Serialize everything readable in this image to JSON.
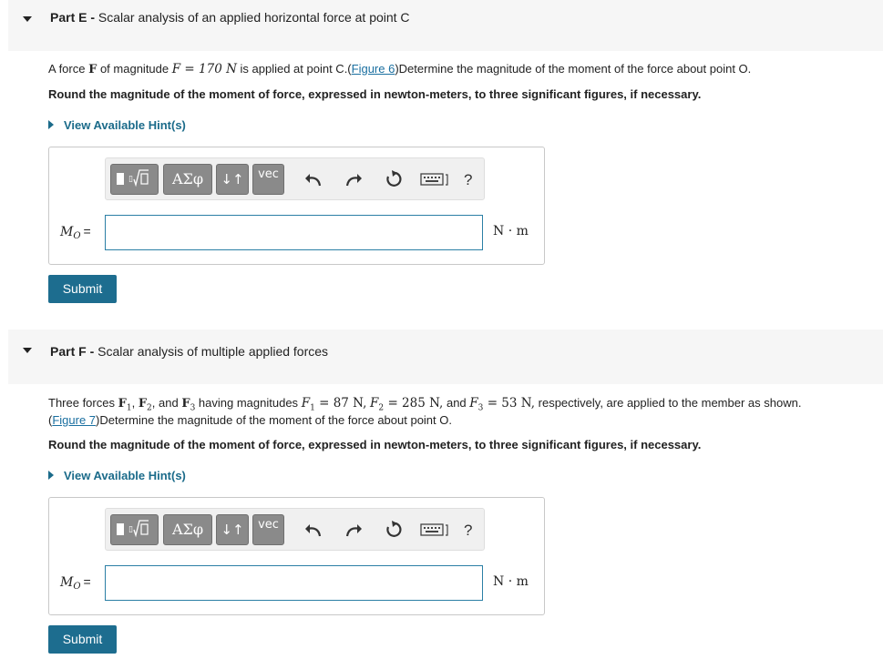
{
  "partE": {
    "label": "Part E -",
    "title": "Scalar analysis of an applied horizontal force at point C",
    "text_pre": "A force",
    "force_symbol": "F",
    "text_mid": "of magnitude",
    "magnitude_eq": "F = 170 N",
    "text_after_mag": "is applied at point C.(",
    "figure_link": "Figure 6",
    "text_post": ")Determine the magnitude of the moment of the force about point O.",
    "instruction": "Round the magnitude of the moment of force, expressed in newton-meters, to three significant figures, if necessary.",
    "hint": "View Available Hint(s)",
    "answer_label": "M",
    "answer_label_sub": "O",
    "answer_label_eq": "=",
    "answer_value": "",
    "unit": "N · m",
    "submit": "Submit"
  },
  "partF": {
    "label": "Part F -",
    "title": "Scalar analysis of multiple applied forces",
    "text_pre": "Three forces",
    "f1": "F",
    "f1_sub": "1",
    "f2": "F",
    "f2_sub": "2",
    "and1": ", and",
    "f3": "F",
    "f3_sub": "3",
    "text_mid": "having magnitudes",
    "m1": "F",
    "m1_sub": "1",
    "m1_val": "= 87 N,",
    "m2": "F",
    "m2_sub": "2",
    "m2_val": "= 285 N,",
    "and2": "and",
    "m3": "F",
    "m3_sub": "3",
    "m3_val": "= 53 N,",
    "text_end": "respectively, are applied to the member as shown.",
    "line2_open": "(",
    "figure_link": "Figure 7",
    "text_post": ")Determine the magnitude of the moment of the force about point O.",
    "instruction": "Round the magnitude of the moment of force, expressed in newton-meters, to three significant figures, if necessary.",
    "hint": "View Available Hint(s)",
    "answer_label": "M",
    "answer_label_sub": "O",
    "answer_label_eq": "=",
    "answer_value": "",
    "unit": "N · m",
    "submit": "Submit"
  },
  "toolbar": {
    "greek_label": "ΑΣφ",
    "arrows_label": "↓↑",
    "vec_label": "vec",
    "help_label": "?",
    "icons": [
      "templates-icon",
      "undo-icon",
      "redo-icon",
      "reset-icon",
      "keyboard-icon"
    ]
  },
  "colors": {
    "accent": "#1d6d8f",
    "link": "#1a6fa0",
    "header_bg": "#f6f6f6",
    "toolbar_button": "#8a8a8a"
  }
}
